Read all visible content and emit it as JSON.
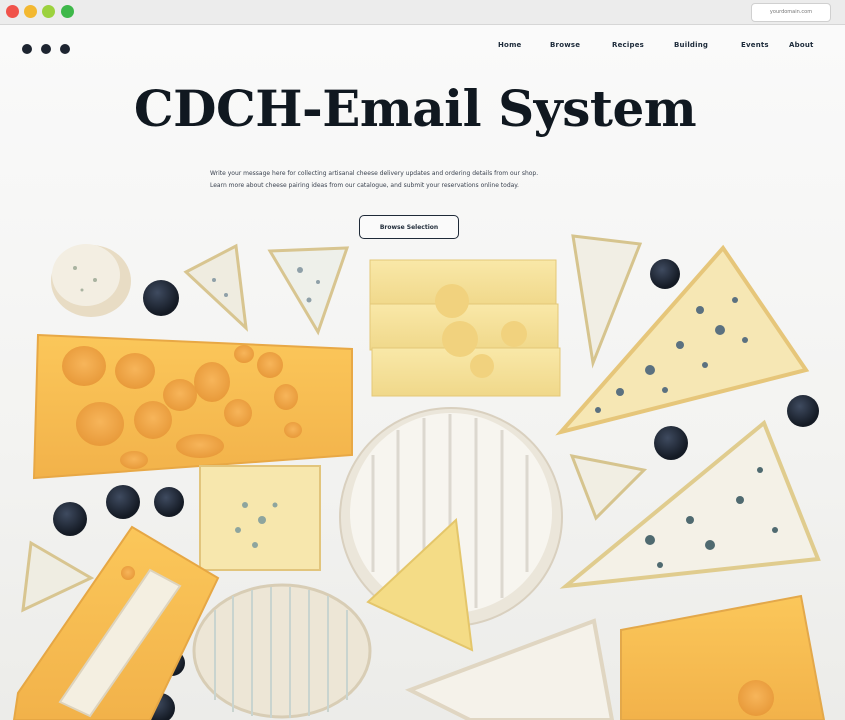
{
  "browser": {
    "url_text": "yourdomain.com"
  },
  "header": {
    "nav": [
      {
        "label": "Home"
      },
      {
        "label": "Browse"
      },
      {
        "label": "Recipes"
      },
      {
        "label": "Building"
      },
      {
        "label": "Events"
      },
      {
        "label": "About"
      }
    ]
  },
  "hero": {
    "title": "CDCH-Email System",
    "subtitle_lines": [
      "Write your message here for collecting artisanal cheese delivery updates and ordering details from our shop.",
      "Learn more about cheese pairing ideas from our catalogue, and submit your reservations online today."
    ],
    "cta_label": "Browse Selection"
  },
  "colors": {
    "accent_dark": "#101820",
    "cheese_yellow": "#f6c45a",
    "cheese_pale": "#f4e3a8",
    "brie_rind": "#f2efe6",
    "blueberry": "#1c2330"
  }
}
